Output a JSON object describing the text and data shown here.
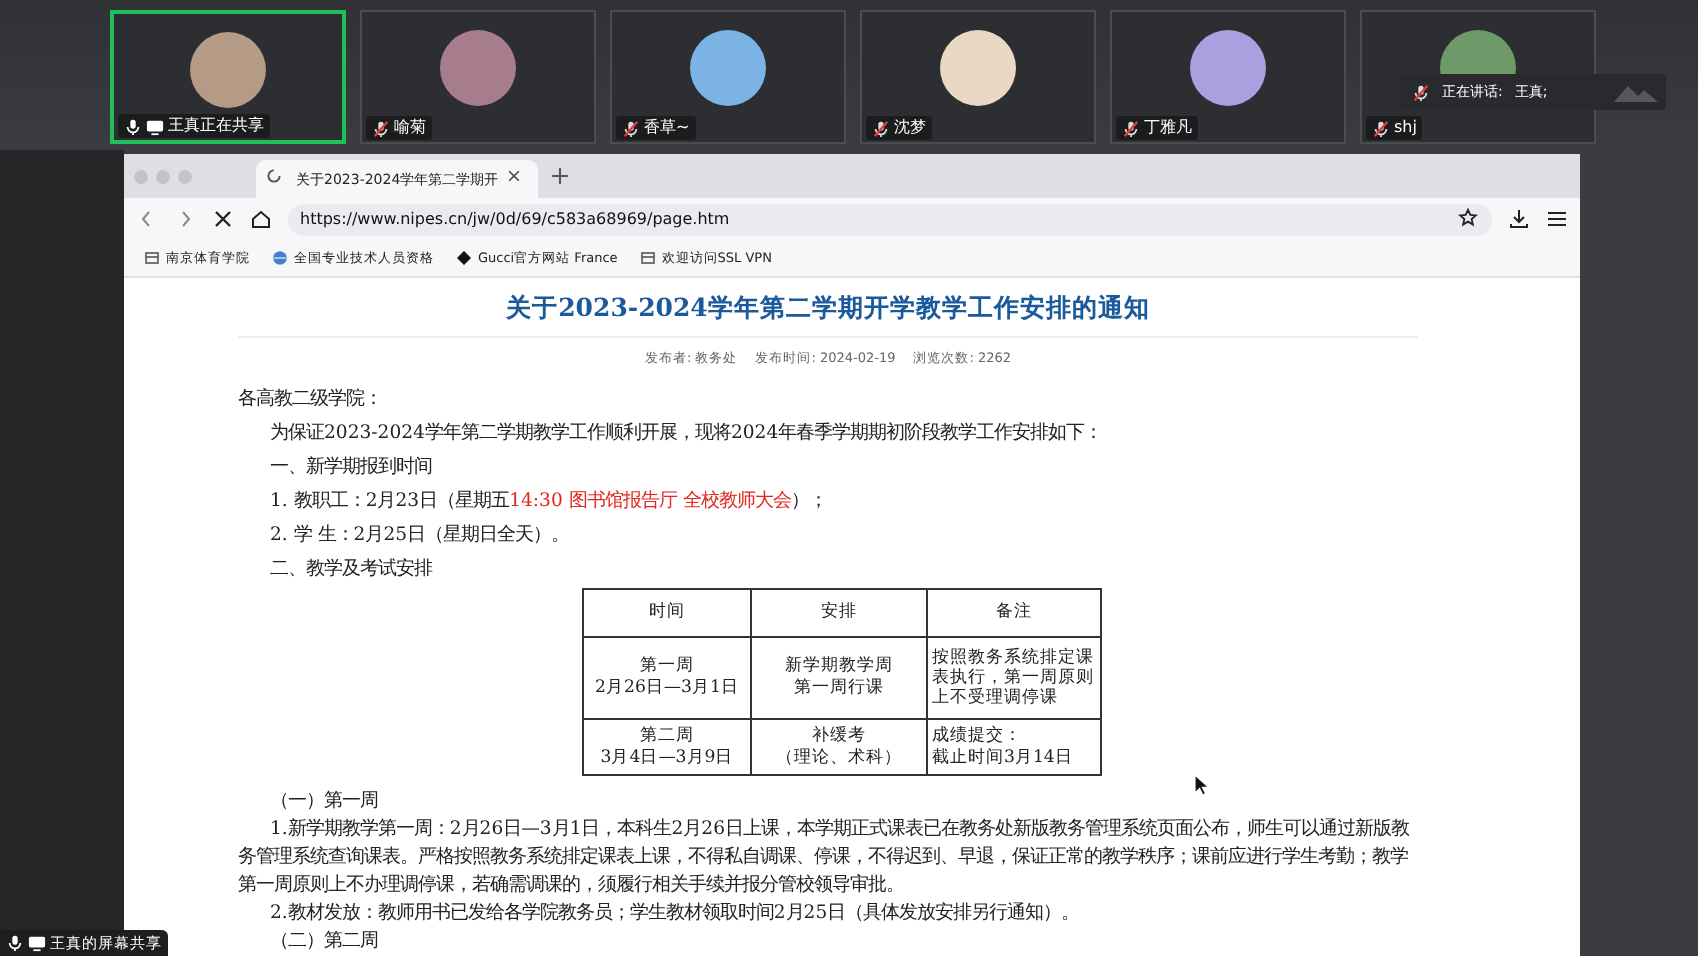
{
  "participants": [
    {
      "name": "王真正在共享",
      "selected": true,
      "muted": false,
      "sharing": true,
      "color": "#b59a86"
    },
    {
      "name": "喻菊",
      "selected": false,
      "muted": true,
      "sharing": false,
      "color": "#a77d8e"
    },
    {
      "name": "香草~",
      "selected": false,
      "muted": true,
      "sharing": false,
      "color": "#7db4e6"
    },
    {
      "name": "沈梦",
      "selected": false,
      "muted": true,
      "sharing": false,
      "color": "#e9d9c4"
    },
    {
      "name": "丁雅凡",
      "selected": false,
      "muted": true,
      "sharing": false,
      "color": "#a9a0e0"
    },
    {
      "name": "shj",
      "selected": false,
      "muted": true,
      "sharing": false,
      "color": "#6e9a6a"
    }
  ],
  "speaking": {
    "label": "正在讲话:",
    "name": "王真;"
  },
  "browser": {
    "tab_title": "关于2023-2024学年第二学期开",
    "url": "https://www.nipes.cn/jw/0d/69/c583a68969/page.htm",
    "bookmarks": [
      {
        "kind": "page",
        "label": "南京体育学院"
      },
      {
        "kind": "globe",
        "label": "全国专业技术人员资格"
      },
      {
        "kind": "diamond",
        "label": "Gucci官方网站 France"
      },
      {
        "kind": "page",
        "label": "欢迎访问SSL VPN"
      }
    ]
  },
  "notice": {
    "title": "关于2023-2024学年第二学期开学教学工作安排的通知",
    "meta": [
      "发布者:  教务处",
      "发布时间:  2024-02-19",
      "浏览次数:  2262"
    ],
    "paragraphs": [
      {
        "kind": "salutation",
        "text": "各高教二级学院："
      },
      {
        "kind": "body",
        "text": "为保证2023-2024学年第二学期教学工作顺利开展，现将2024年春季学期期初阶段教学工作安排如下："
      },
      {
        "kind": "body",
        "text": "一、新学期报到时间"
      },
      {
        "kind": "body",
        "runs": [
          {
            "text": "1. 教职工：2月23日（星期五",
            "emphasis": false
          },
          {
            "text": "14:30 图书馆报告厅 全校教师大会",
            "emphasis": true
          },
          {
            "text": "）；",
            "emphasis": false
          }
        ]
      },
      {
        "kind": "body",
        "text": "2. 学  生：2月25日（星期日全天）。"
      },
      {
        "kind": "body",
        "text": "二、教学及考试安排"
      }
    ],
    "table": {
      "columns": [
        "时间",
        "安排",
        "备注"
      ],
      "rows": [
        [
          [
            "第一周",
            "2月26日—3月1日"
          ],
          [
            "新学期教学周",
            "第一周行课"
          ],
          [
            "按照教务系统排定课表执行，第一周原则上不受理调停课"
          ]
        ],
        [
          [
            "第二周",
            "3月4日—3月9日"
          ],
          [
            "补缓考",
            "（理论、术科）"
          ],
          [
            "成绩提交：",
            "截止时间3月14日"
          ]
        ]
      ]
    },
    "paragraphs_after": [
      {
        "kind": "body",
        "text": "（一）第一周"
      },
      {
        "kind": "body",
        "text": "1.新学期教学第一周：2月26日—3月1日，本科生2月26日上课，本学期正式课表已在教务处新版教务管理系统页面公布，师生可以通过新版教务管理系统查询课表。严格按照教务系统排定课表上课，不得私自调课、停课，不得迟到、早退，保证正常的教学秩序；课前应进行学生考勤；教学第一周原则上不办理调停课，若确需调课的，须履行相关手续并报分管校领导审批。"
      },
      {
        "kind": "body",
        "text": "2.教材发放：教师用书已发给各学院教务员；学生教材领取时间2月25日（具体发放安排另行通知）。"
      },
      {
        "kind": "body",
        "text": "（二）第二周"
      }
    ]
  },
  "share_label": "王真的屏幕共享"
}
